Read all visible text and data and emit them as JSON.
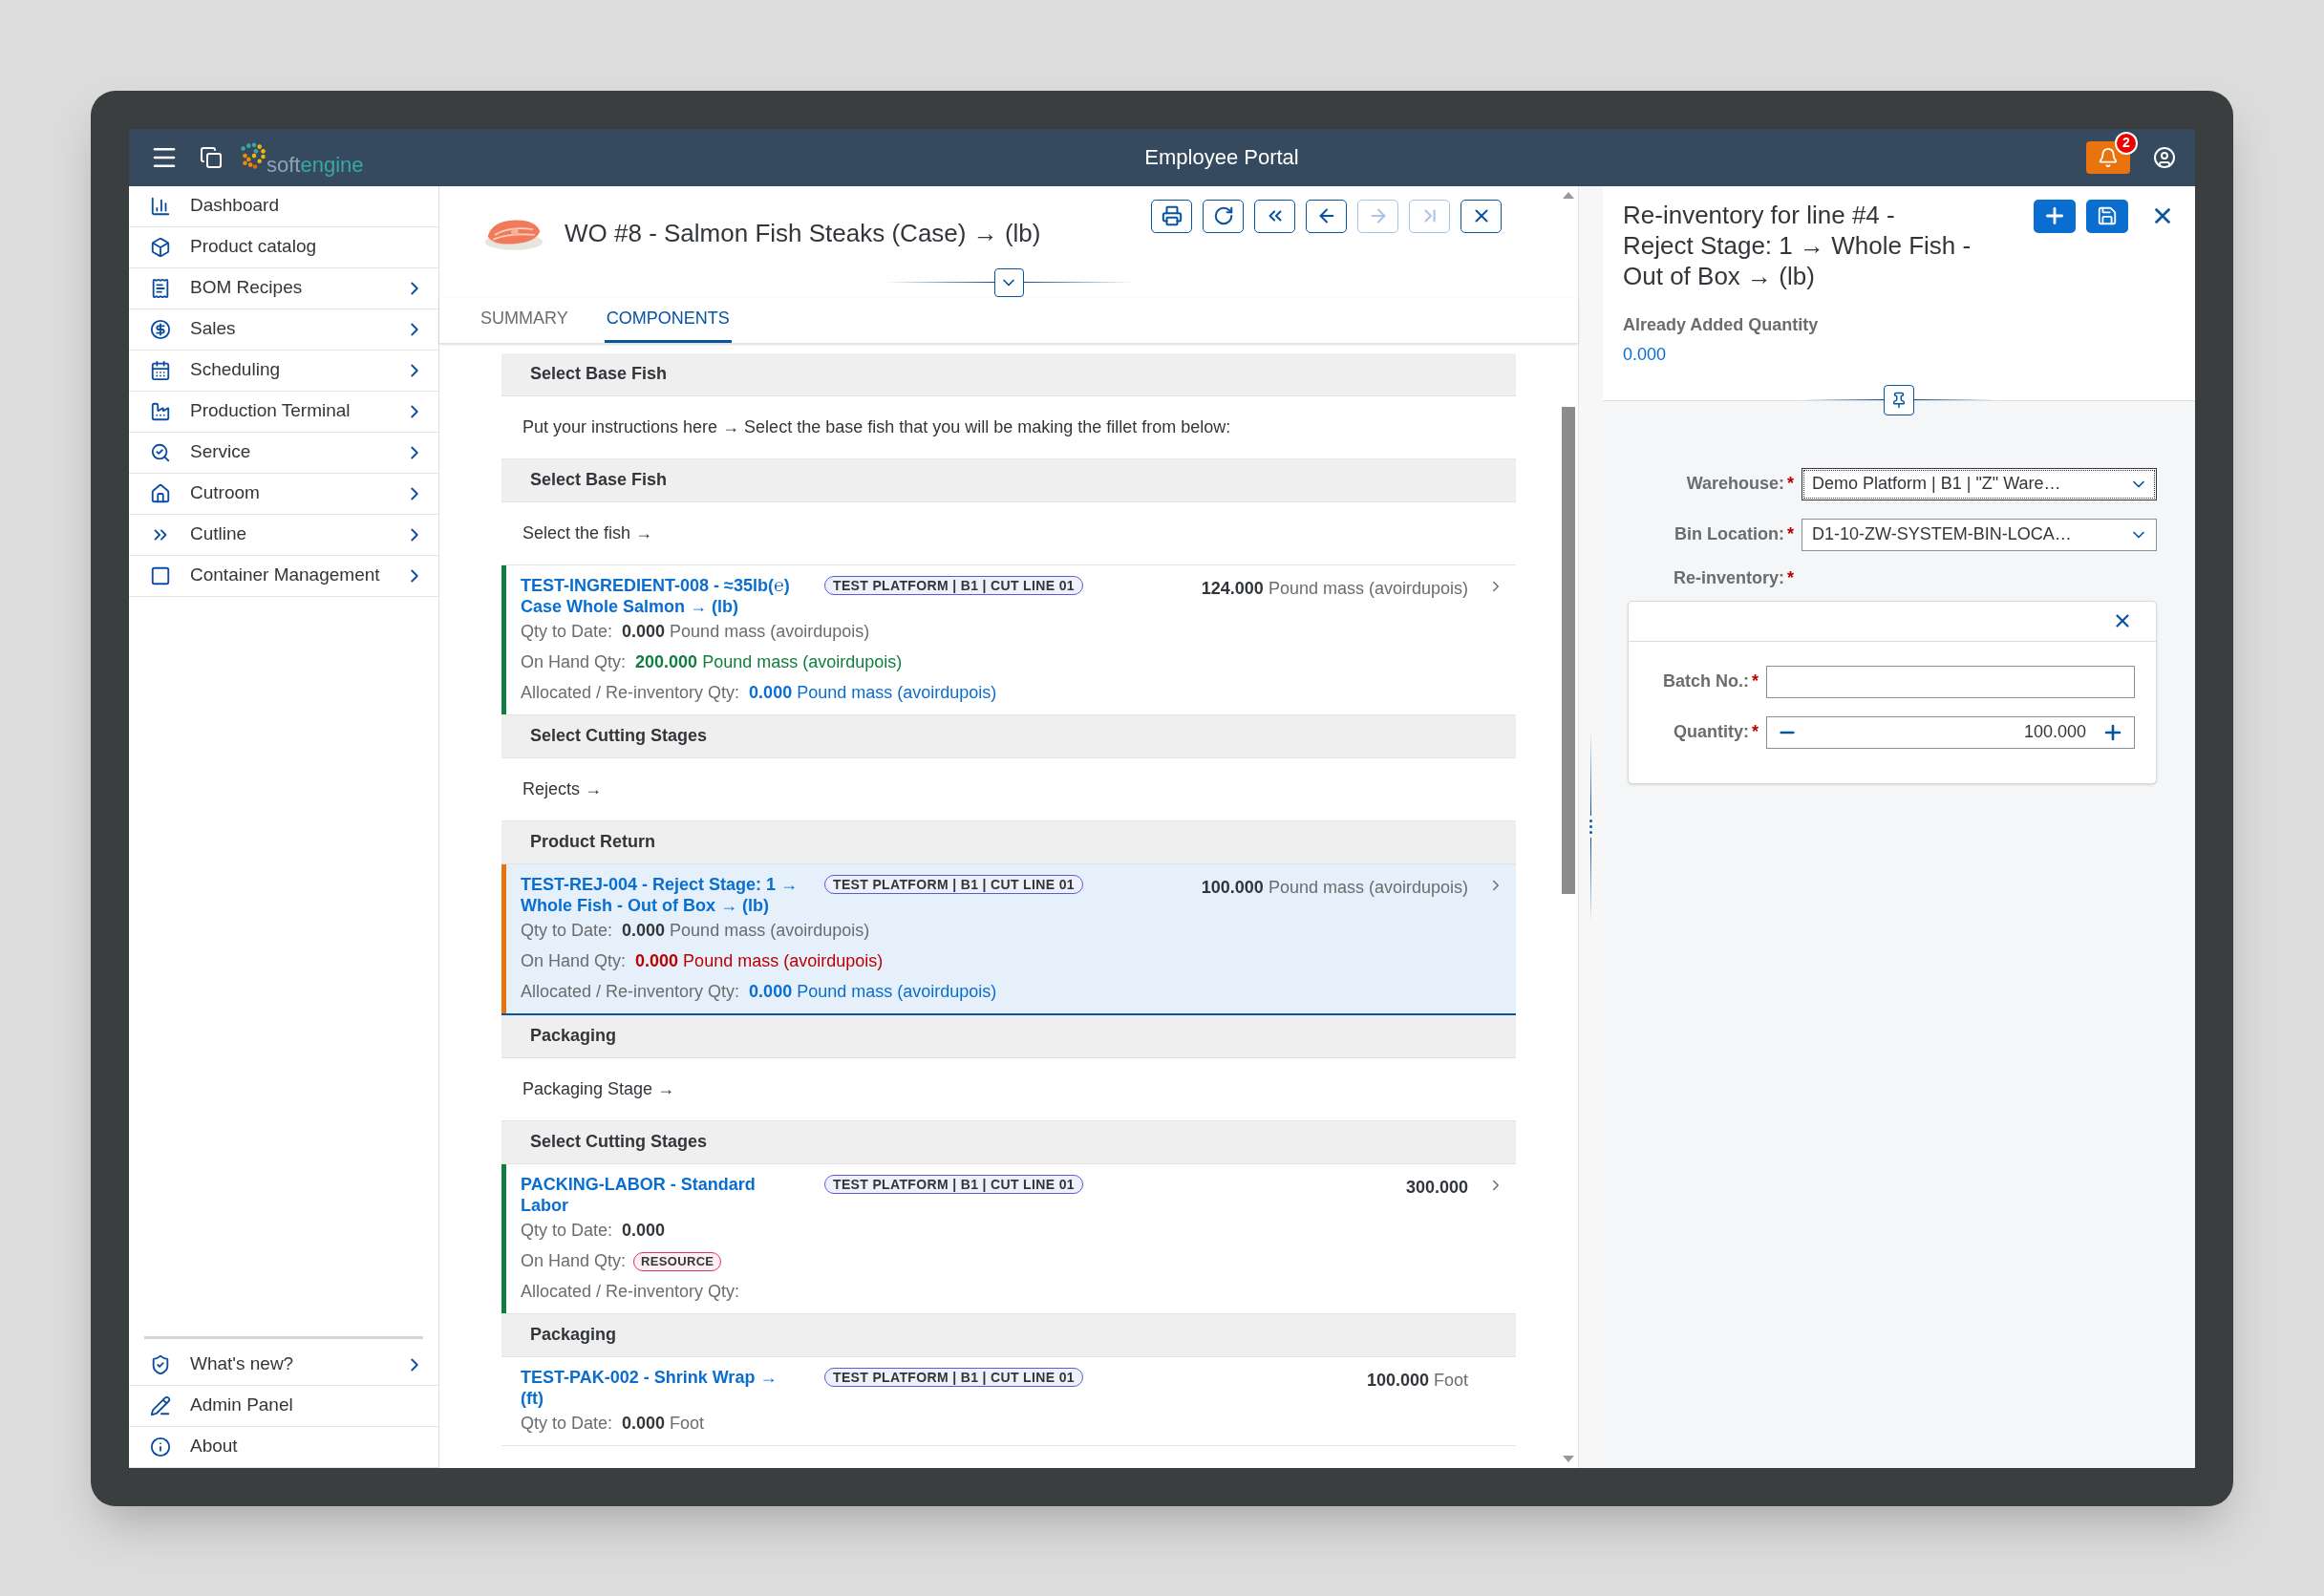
{
  "header": {
    "logo": [
      "soft",
      "engine"
    ],
    "title": "Employee Portal",
    "notifications": "2"
  },
  "sidebar": {
    "items": [
      {
        "label": "Dashboard",
        "expandable": false
      },
      {
        "label": "Product catalog",
        "expandable": false
      },
      {
        "label": "BOM Recipes",
        "expandable": true
      },
      {
        "label": "Sales",
        "expandable": true
      },
      {
        "label": "Scheduling",
        "expandable": true
      },
      {
        "label": "Production Terminal",
        "expandable": true
      },
      {
        "label": "Service",
        "expandable": true
      },
      {
        "label": "Cutroom",
        "expandable": true
      },
      {
        "label": "Cutline",
        "expandable": true
      },
      {
        "label": "Container Management",
        "expandable": true
      }
    ],
    "footer_items": [
      {
        "label": "What's new?",
        "expandable": true
      },
      {
        "label": "Admin Panel",
        "expandable": false
      },
      {
        "label": "About",
        "expandable": false
      }
    ]
  },
  "work_order": {
    "title": "WO #8 - Salmon Fish Steaks (Case) → (lb)",
    "toolbar": [
      {
        "kind": "print",
        "disabled": false
      },
      {
        "kind": "refresh",
        "disabled": false
      },
      {
        "kind": "first",
        "disabled": false
      },
      {
        "kind": "previous",
        "disabled": false
      },
      {
        "kind": "next",
        "disabled": true
      },
      {
        "kind": "last",
        "disabled": true
      },
      {
        "kind": "close",
        "disabled": false
      }
    ],
    "tabs": [
      {
        "label": "SUMMARY",
        "selected": false
      },
      {
        "label": "COMPONENTS",
        "selected": true
      }
    ],
    "rows": [
      {
        "kind": "header",
        "text": "Select Base Fish"
      },
      {
        "kind": "text",
        "text": "Put your instructions here → Select the base fish that you will be making the fillet from below:"
      },
      {
        "kind": "header",
        "text": "Select Base Fish"
      },
      {
        "kind": "text",
        "text": "Select the fish →"
      },
      {
        "kind": "component",
        "title": "TEST-INGREDIENT-008 - ≈35lb(℮) Case Whole Salmon → (lb)",
        "color": "#107e3e",
        "selected": false,
        "navigable": true,
        "tag": "TEST PLATFORM | B1 | CUT LINE 01",
        "amount": "124.000",
        "unit": "Pound mass (avoirdupois)",
        "details": [
          {
            "label": "Qty to Date:",
            "value": "0.000",
            "unit": "Pound mass (avoirdupois)"
          },
          {
            "label": "On Hand Qty:",
            "value": "200.000",
            "unit": "Pound mass (avoirdupois)",
            "color": "#107e3e"
          },
          {
            "label": "Allocated / Re-inventory Qty:",
            "value": "0.000",
            "unit": "Pound mass (avoirdupois)",
            "color": "#0a6ed1"
          }
        ]
      },
      {
        "kind": "header",
        "text": "Select Cutting Stages"
      },
      {
        "kind": "text",
        "text": "Rejects →"
      },
      {
        "kind": "header",
        "text": "Product Return"
      },
      {
        "kind": "component",
        "title": "TEST-REJ-004 - Reject Stage: 1 → Whole Fish - Out of Box → (lb)",
        "color": "#e9730c",
        "selected": true,
        "navigable": true,
        "tag": "TEST PLATFORM | B1 | CUT LINE 01",
        "amount": "100.000",
        "unit": "Pound mass (avoirdupois)",
        "details": [
          {
            "label": "Qty to Date:",
            "value": "0.000",
            "unit": "Pound mass (avoirdupois)"
          },
          {
            "label": "On Hand Qty:",
            "value": "0.000",
            "unit": "Pound mass (avoirdupois)",
            "color": "#bb0000"
          },
          {
            "label": "Allocated / Re-inventory Qty:",
            "value": "0.000",
            "unit": "Pound mass (avoirdupois)",
            "color": "#0a6ed1"
          }
        ]
      },
      {
        "kind": "header",
        "text": "Packaging"
      },
      {
        "kind": "text",
        "text": "Packaging Stage →"
      },
      {
        "kind": "header",
        "text": "Select Cutting Stages"
      },
      {
        "kind": "component",
        "title": "PACKING-LABOR - Standard Labor",
        "color": "#107e3e",
        "selected": false,
        "navigable": true,
        "tag": "TEST PLATFORM | B1 | CUT LINE 01",
        "amount": "300.000",
        "details": [
          {
            "label": "Qty to Date:",
            "value": "0.000"
          },
          {
            "label": "On Hand Qty:",
            "badge": "RESOURCE"
          },
          {
            "label": "Allocated / Re-inventory Qty:"
          }
        ]
      },
      {
        "kind": "header",
        "text": "Packaging"
      },
      {
        "kind": "component",
        "title": "TEST-PAK-002 - Shrink Wrap → (ft)",
        "selected": false,
        "navigable": false,
        "tag": "TEST PLATFORM | B1 | CUT LINE 01",
        "amount": "100.000",
        "unit": "Foot",
        "details": [
          {
            "label": "Qty to Date:",
            "value": "0.000",
            "unit": "Foot"
          }
        ]
      }
    ]
  },
  "side_panel": {
    "title": "Re-inventory for line #4 - Reject Stage: 1 → Whole Fish - Out of Box → (lb)",
    "already_added": {
      "label": "Already Added Quantity",
      "value": "0.000"
    },
    "fields": [
      {
        "label": "Warehouse:",
        "required_mark": "*",
        "value": "Demo Platform | B1 | \"Z\" Ware…",
        "focused": true
      },
      {
        "label": "Bin Location:",
        "required_mark": "*",
        "value": "D1-10-ZW-SYSTEM-BIN-LOCA…",
        "focused": false
      }
    ],
    "reinventory": {
      "label": "Re-inventory:",
      "required_mark": "*",
      "batch": {
        "label": "Batch No.:",
        "required_mark": "*"
      },
      "quantity": {
        "label": "Quantity:",
        "required_mark": "*",
        "value": "100.000"
      }
    }
  }
}
